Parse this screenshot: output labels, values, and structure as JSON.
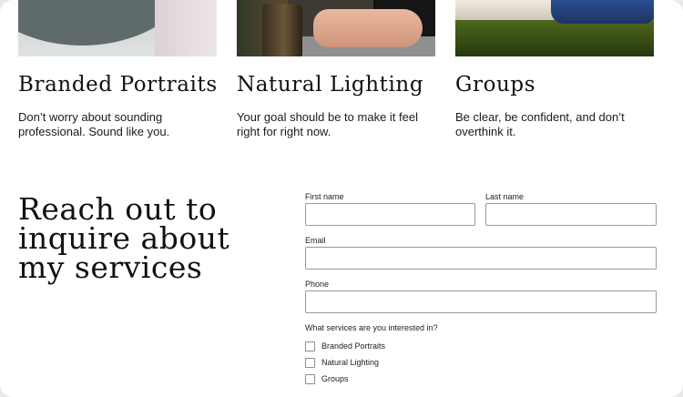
{
  "services": [
    {
      "title": "Branded Portraits",
      "description": "Don’t worry about sounding professional. Sound like you.",
      "image": "portrait-photo"
    },
    {
      "title": "Natural Lighting",
      "description": "Your goal should be to make it feel right for right now.",
      "image": "natural-light-photo"
    },
    {
      "title": "Groups",
      "description": "Be clear, be confident, and don’t overthink it.",
      "image": "group-photo"
    }
  ],
  "contact": {
    "heading": "Reach out to inquire about my services"
  },
  "form": {
    "first_name_label": "First name",
    "first_name_value": "",
    "last_name_label": "Last name",
    "last_name_value": "",
    "email_label": "Email",
    "email_value": "",
    "phone_label": "Phone",
    "phone_value": "",
    "services_question": "What services are you interested in?",
    "service_options": [
      {
        "label": "Branded Portraits",
        "checked": false
      },
      {
        "label": "Natural Lighting",
        "checked": false
      },
      {
        "label": "Groups",
        "checked": false
      }
    ]
  }
}
